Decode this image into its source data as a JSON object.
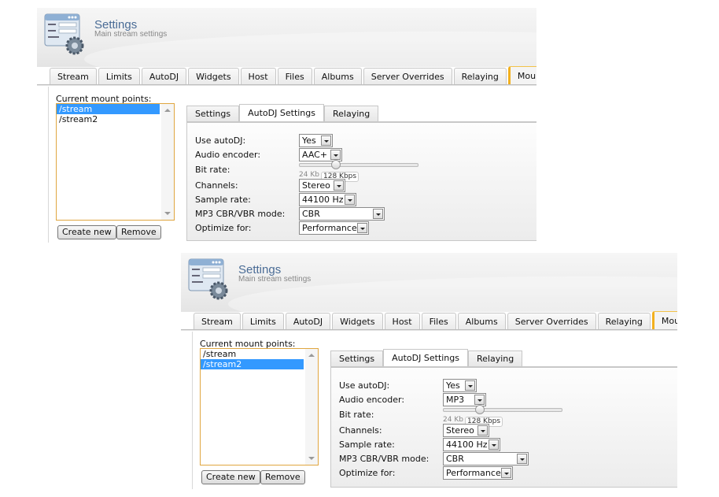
{
  "panels": [
    {
      "header": {
        "title": "Settings",
        "subtitle": "Main stream settings",
        "icon": "settings-form-gear-icon"
      },
      "tabs": [
        "Stream",
        "Limits",
        "AutoDJ",
        "Widgets",
        "Host",
        "Files",
        "Albums",
        "Server Overrides",
        "Relaying",
        "Mount Points"
      ],
      "active_tab": "Mount Points",
      "mount_points": {
        "label": "Current mount points:",
        "items": [
          "/stream",
          "/stream2"
        ],
        "selected": "/stream"
      },
      "buttons": {
        "create": "Create new",
        "remove": "Remove"
      },
      "subtabs": [
        "Settings",
        "AutoDJ Settings",
        "Relaying"
      ],
      "active_subtab": "AutoDJ Settings",
      "form": {
        "use_autodj": {
          "label": "Use autoDJ:",
          "value": "Yes"
        },
        "audio_encoder": {
          "label": "Audio encoder:",
          "value": "AAC+"
        },
        "bit_rate": {
          "label": "Bit rate:",
          "min_label": "24 Kb",
          "value_label": "128 Kbps",
          "fraction": 0.3
        },
        "channels": {
          "label": "Channels:",
          "value": "Stereo"
        },
        "sample_rate": {
          "label": "Sample rate:",
          "value": "44100 Hz"
        },
        "mode": {
          "label": "MP3 CBR/VBR mode:",
          "value": "CBR"
        },
        "optimize": {
          "label": "Optimize for:",
          "value": "Performance"
        }
      }
    },
    {
      "header": {
        "title": "Settings",
        "subtitle": "Main stream settings",
        "icon": "settings-form-gear-icon"
      },
      "tabs": [
        "Stream",
        "Limits",
        "AutoDJ",
        "Widgets",
        "Host",
        "Files",
        "Albums",
        "Server Overrides",
        "Relaying",
        "Mount Points"
      ],
      "active_tab": "Mount Points",
      "mount_points": {
        "label": "Current mount points:",
        "items": [
          "/stream",
          "/stream2"
        ],
        "selected": "/stream2"
      },
      "buttons": {
        "create": "Create new",
        "remove": "Remove"
      },
      "subtabs": [
        "Settings",
        "AutoDJ Settings",
        "Relaying"
      ],
      "active_subtab": "AutoDJ Settings",
      "form": {
        "use_autodj": {
          "label": "Use autoDJ:",
          "value": "Yes"
        },
        "audio_encoder": {
          "label": "Audio encoder:",
          "value": "MP3"
        },
        "bit_rate": {
          "label": "Bit rate:",
          "min_label": "24 Kb",
          "value_label": "128 Kbps",
          "fraction": 0.3
        },
        "channels": {
          "label": "Channels:",
          "value": "Stereo"
        },
        "sample_rate": {
          "label": "Sample rate:",
          "value": "44100 Hz"
        },
        "mode": {
          "label": "MP3 CBR/VBR mode:",
          "value": "CBR"
        },
        "optimize": {
          "label": "Optimize for:",
          "value": "Performance"
        }
      }
    }
  ],
  "colors": {
    "accent_tab": "#f2b01e",
    "selection": "#3399ff",
    "title": "#4a6c96",
    "list_border": "#e0a640"
  }
}
